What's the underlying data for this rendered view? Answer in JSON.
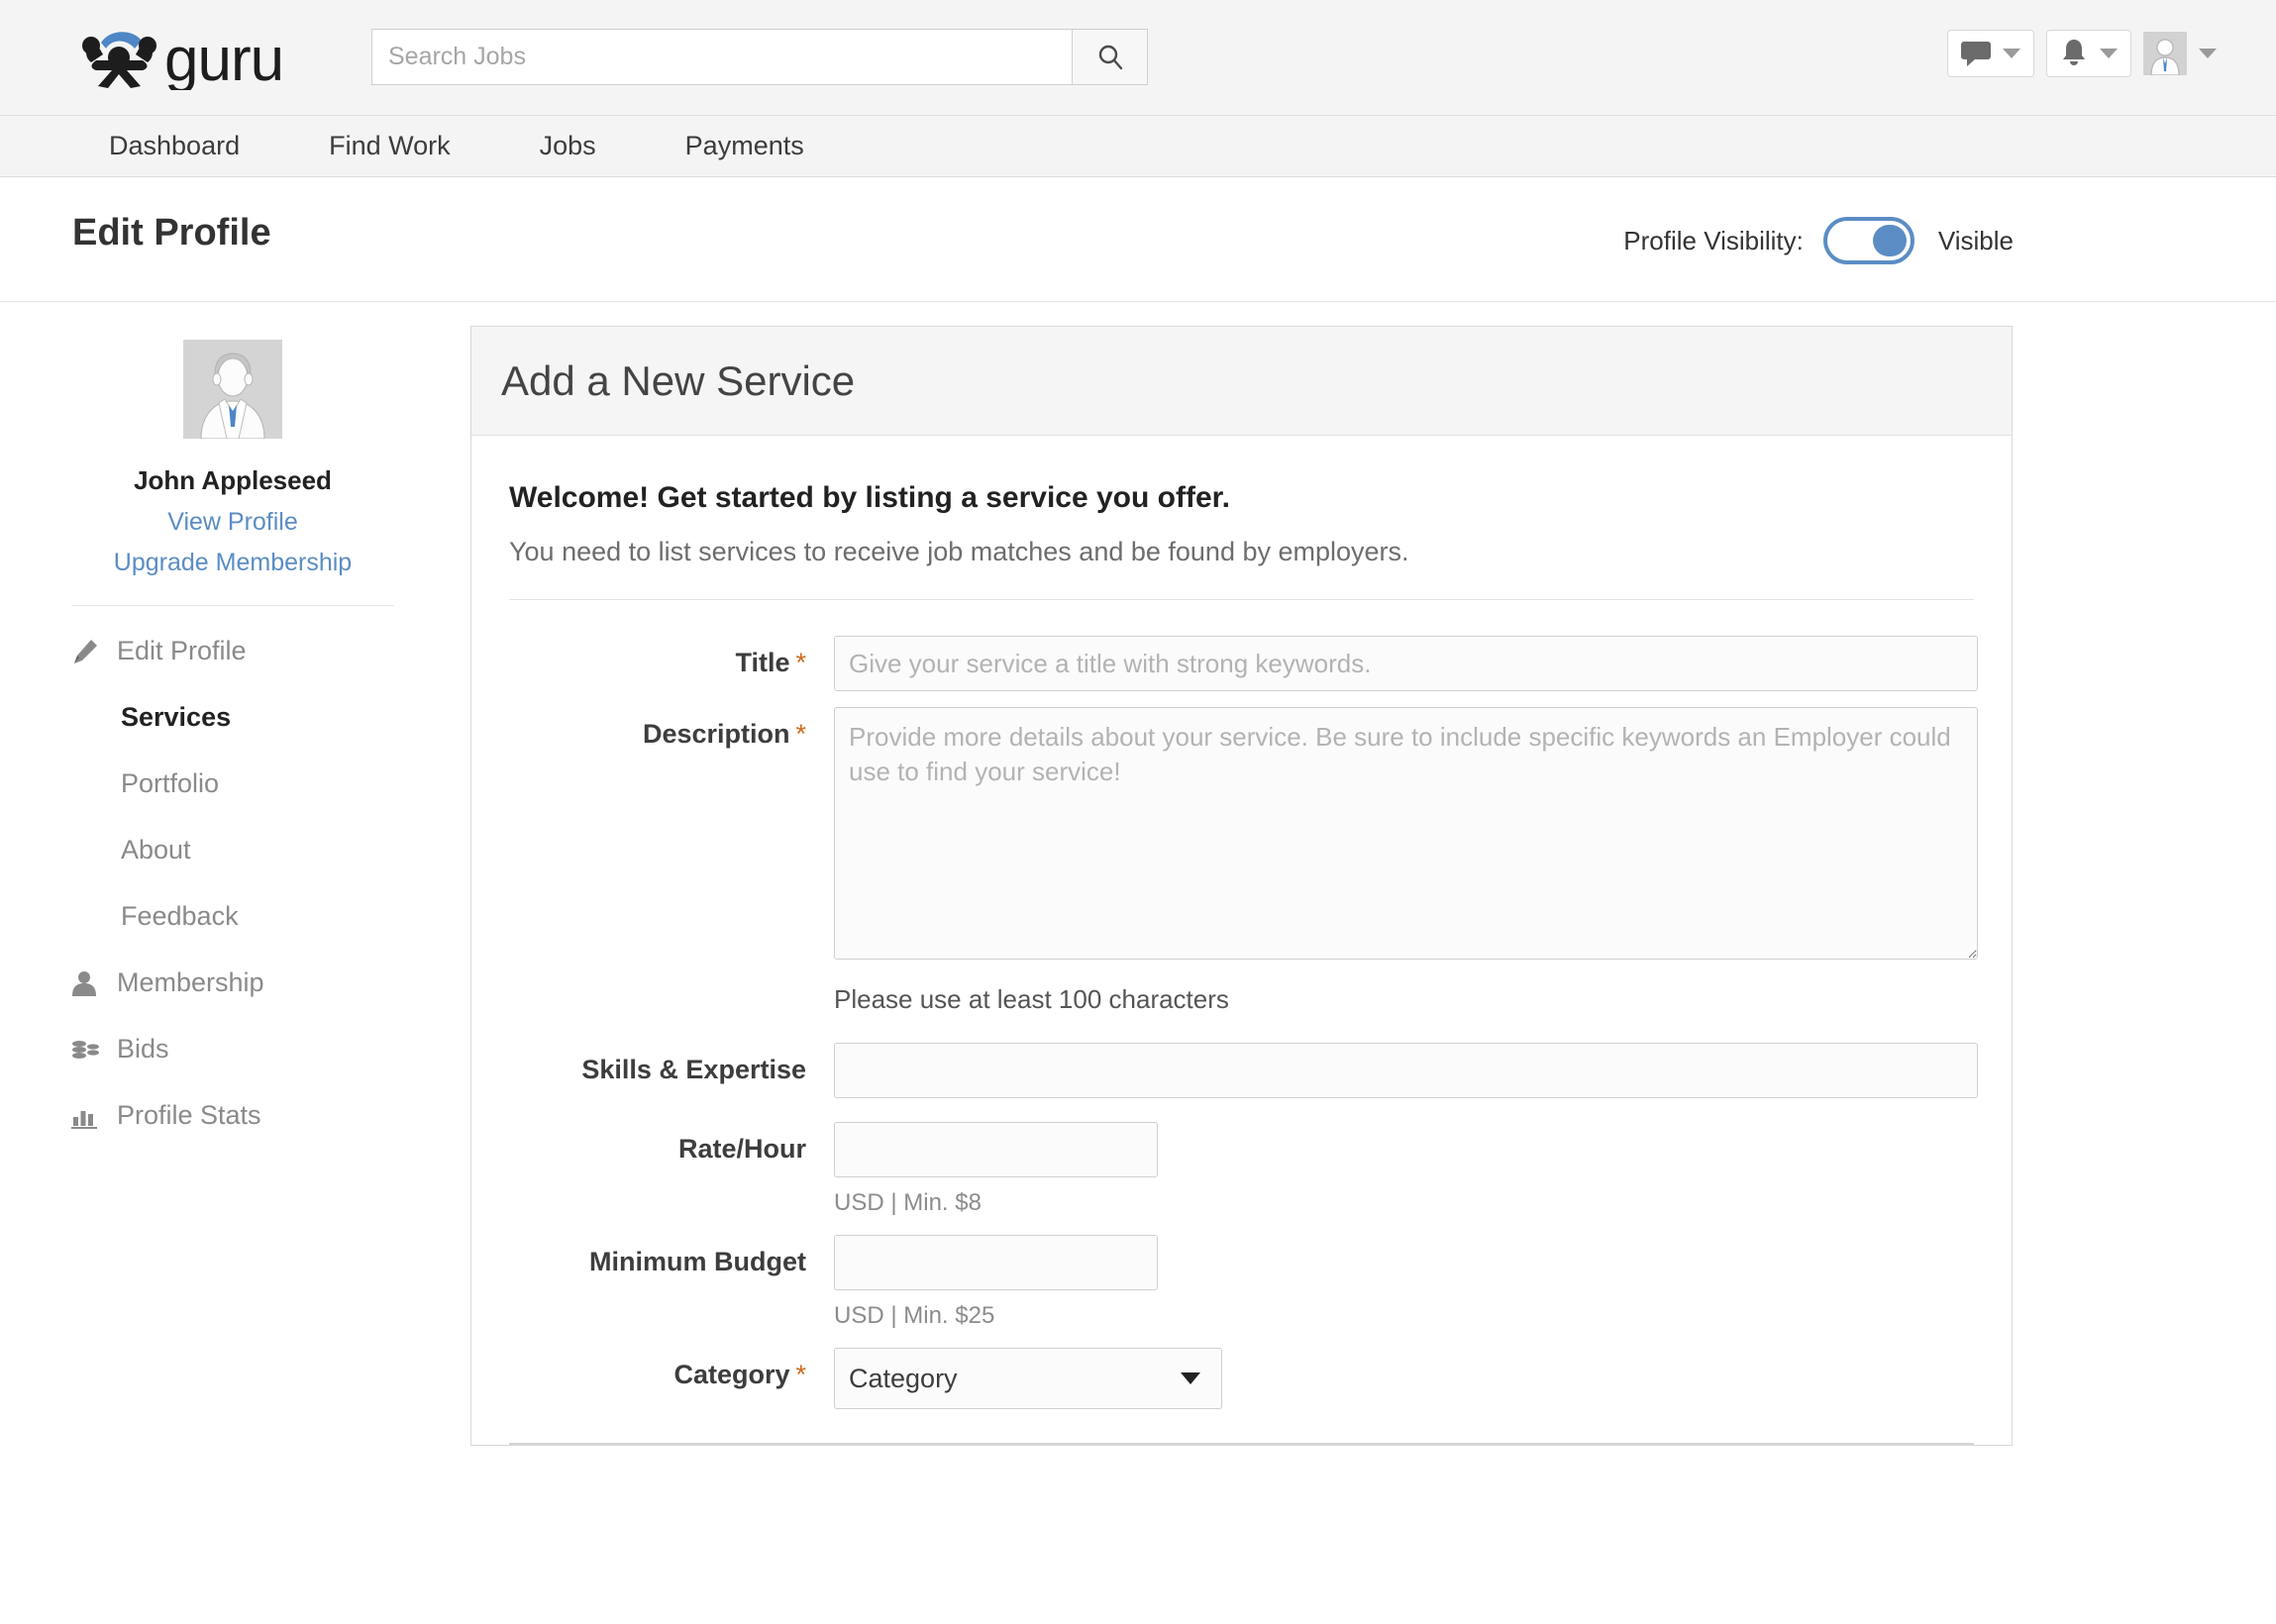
{
  "brand": {
    "name": "guru"
  },
  "search": {
    "placeholder": "Search Jobs",
    "value": ""
  },
  "nav": {
    "items": [
      {
        "label": "Dashboard"
      },
      {
        "label": "Find Work"
      },
      {
        "label": "Jobs"
      },
      {
        "label": "Payments"
      }
    ]
  },
  "page": {
    "title": "Edit Profile",
    "visibility_label": "Profile Visibility:",
    "visibility_state": "Visible",
    "visibility_on": true
  },
  "sidebar": {
    "user_name": "John Appleseed",
    "links": [
      {
        "label": "View Profile"
      },
      {
        "label": "Upgrade Membership"
      }
    ],
    "menu": [
      {
        "label": "Edit Profile",
        "icon": "pencil-icon",
        "active": false
      },
      {
        "label": "Membership",
        "icon": "person-icon",
        "active": false
      },
      {
        "label": "Bids",
        "icon": "coins-icon",
        "active": false
      },
      {
        "label": "Profile Stats",
        "icon": "bar-chart-icon",
        "active": false
      }
    ],
    "submenu": [
      {
        "label": "Services",
        "active": true
      },
      {
        "label": "Portfolio",
        "active": false
      },
      {
        "label": "About",
        "active": false
      },
      {
        "label": "Feedback",
        "active": false
      }
    ]
  },
  "panel": {
    "title": "Add a New Service",
    "welcome_heading": "Welcome! Get started by listing a service you offer.",
    "welcome_sub": "You need to list services to receive job matches and be found by employers.",
    "form": {
      "title": {
        "label": "Title",
        "required": "*",
        "placeholder": "Give your service a title with strong keywords.",
        "value": ""
      },
      "description": {
        "label": "Description",
        "required": "*",
        "placeholder": "Provide more details about your service. Be sure to include specific keywords an Employer could use to find your service!",
        "value": "",
        "hint": "Please use at least 100 characters"
      },
      "skills": {
        "label": "Skills & Expertise",
        "placeholder": "",
        "value": ""
      },
      "rate": {
        "label": "Rate/Hour",
        "placeholder": "",
        "value": "",
        "hint": "USD | Min. $8"
      },
      "min_budget": {
        "label": "Minimum Budget",
        "placeholder": "",
        "value": "",
        "hint": "USD | Min. $25"
      },
      "category": {
        "label": "Category",
        "required": "*",
        "selected": "Category",
        "options": [
          "Category"
        ]
      }
    }
  },
  "colors": {
    "accent_blue": "#5b8dc4",
    "required_orange": "#d2691e",
    "topbar_bg": "#f4f4f4",
    "panel_head_bg": "#f5f5f5"
  },
  "icons": {
    "search": "search-icon",
    "chat": "chat-bubble-icon",
    "bell": "bell-icon",
    "avatar": "avatar-icon",
    "caret": "chevron-down-icon"
  }
}
